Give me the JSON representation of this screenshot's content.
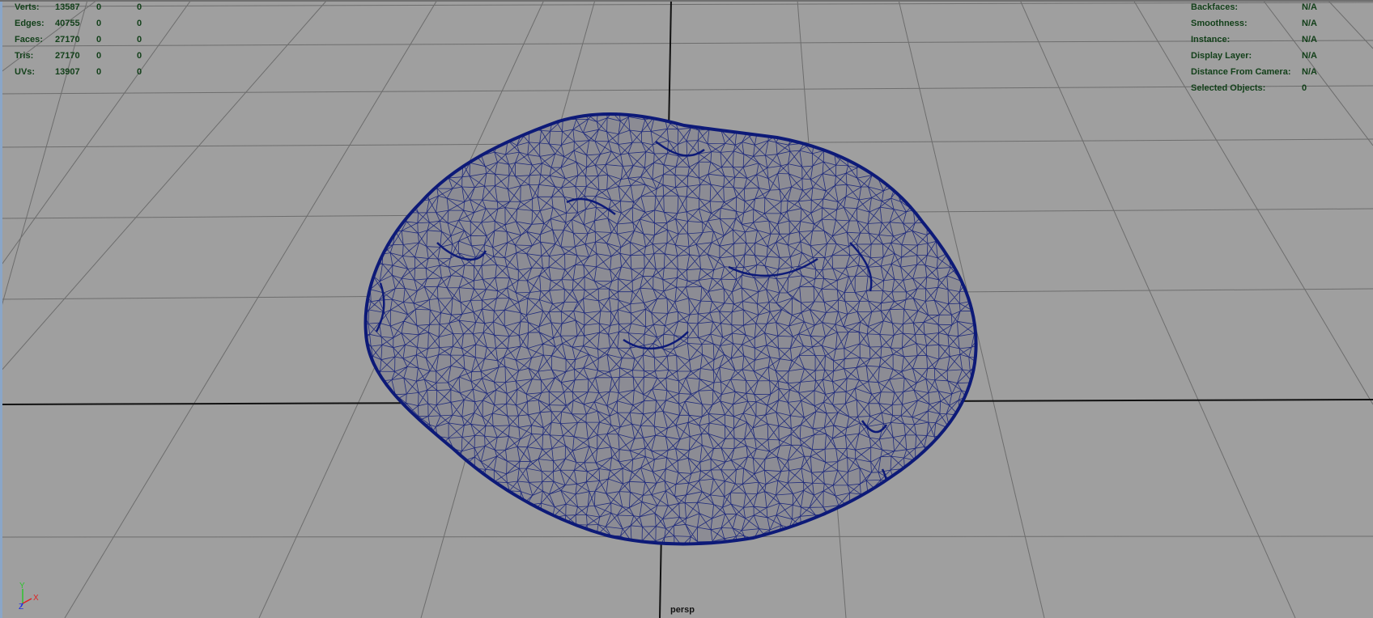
{
  "viewport": {
    "camera": "persp",
    "background_color": "#9f9f9f",
    "grid_color": "#6d6d6d",
    "axis_line_color": "#111111",
    "wireframe_color": "#0d1a78"
  },
  "hud_left": {
    "rows": [
      {
        "label": "Verts:",
        "v1": "13587",
        "v2": "0",
        "v3": "0"
      },
      {
        "label": "Edges:",
        "v1": "40755",
        "v2": "0",
        "v3": "0"
      },
      {
        "label": "Faces:",
        "v1": "27170",
        "v2": "0",
        "v3": "0"
      },
      {
        "label": "Tris:",
        "v1": "27170",
        "v2": "0",
        "v3": "0"
      },
      {
        "label": "UVs:",
        "v1": "13907",
        "v2": "0",
        "v3": "0"
      }
    ]
  },
  "hud_right": {
    "rows": [
      {
        "label": "Backfaces:",
        "value": "N/A"
      },
      {
        "label": "Smoothness:",
        "value": "N/A"
      },
      {
        "label": "Instance:",
        "value": "N/A"
      },
      {
        "label": "Display Layer:",
        "value": "N/A"
      },
      {
        "label": "Distance From Camera:",
        "value": "N/A"
      },
      {
        "label": "Selected Objects:",
        "value": "0"
      }
    ]
  },
  "axis_gizmo": {
    "y_label": "Y",
    "x_label": "X",
    "z_label": "Z",
    "y_color": "#2ec42e",
    "x_color": "#e02020",
    "z_color": "#2030e0"
  }
}
